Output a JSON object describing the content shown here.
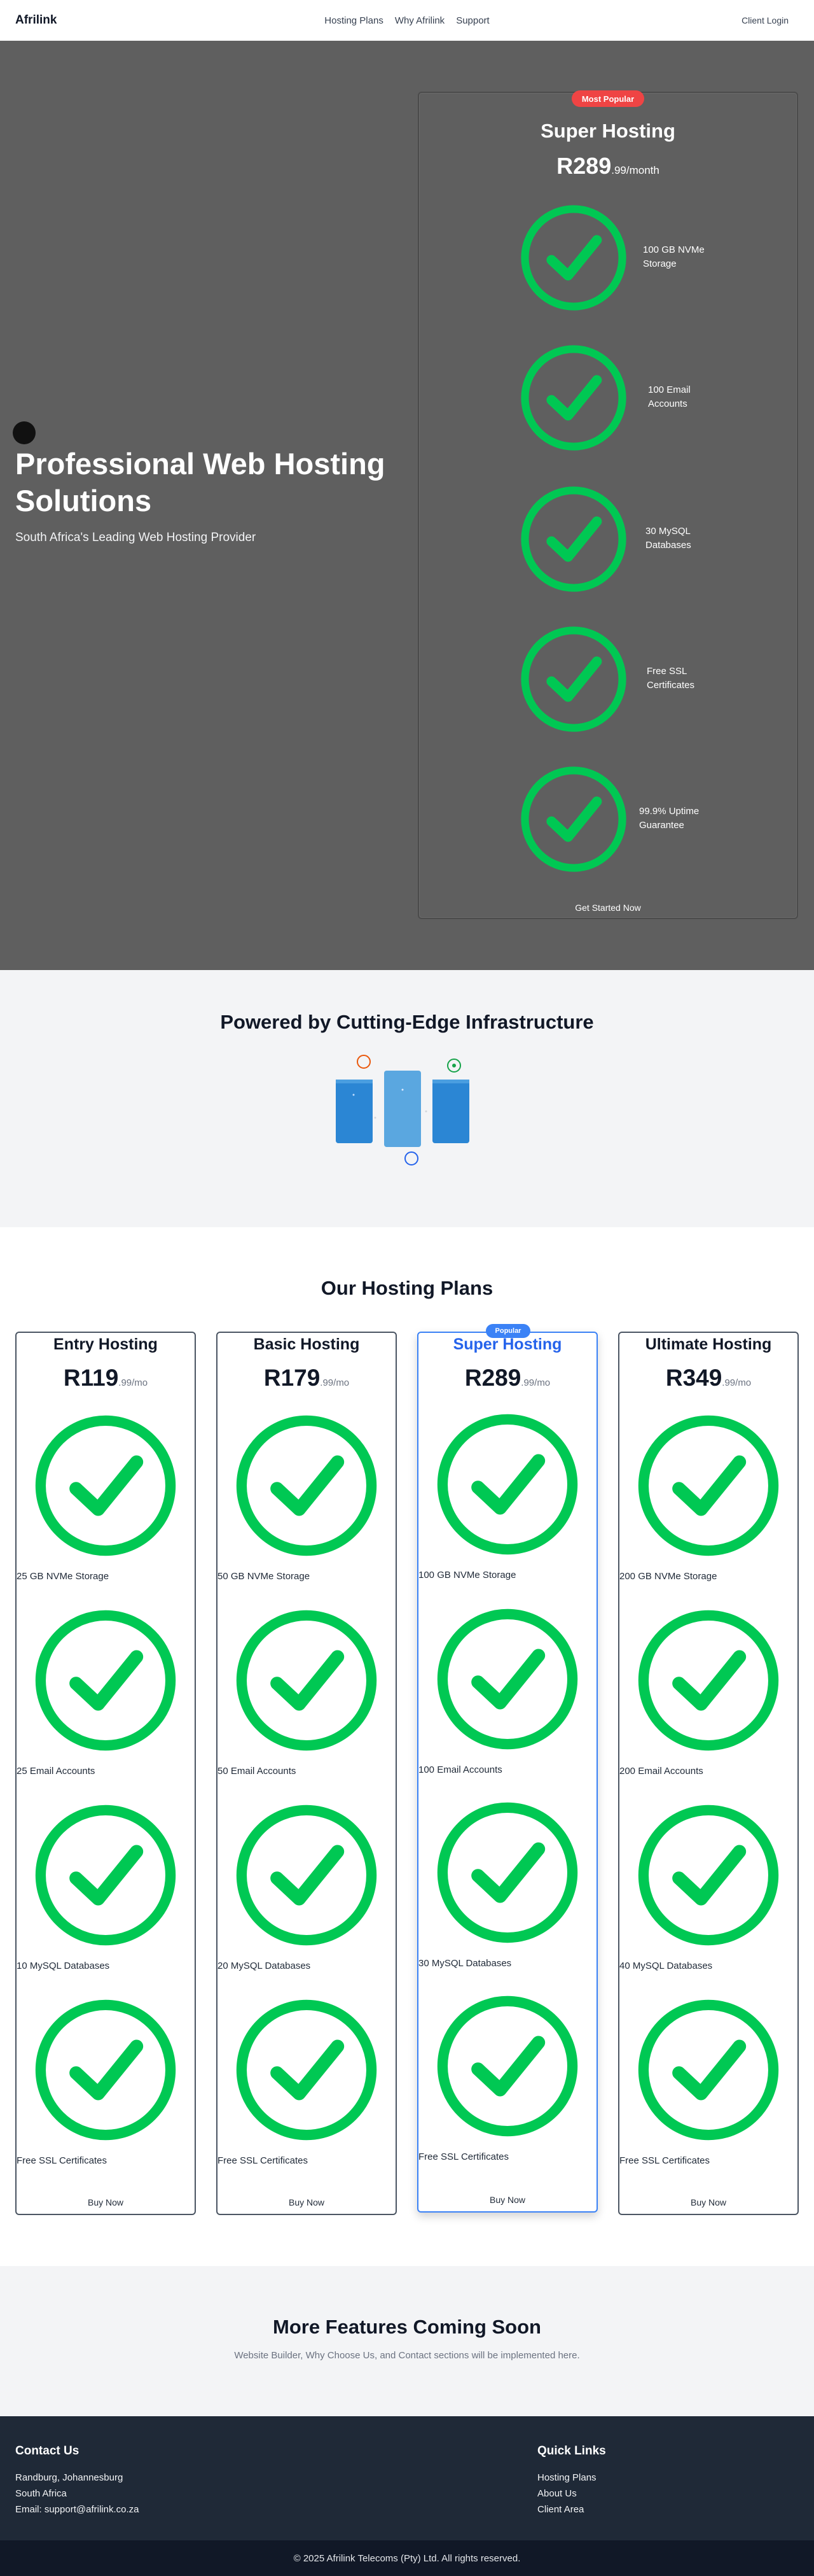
{
  "header": {
    "brand": "Afrilink",
    "nav": [
      "Hosting Plans",
      "Why Afrilink",
      "Support"
    ],
    "client_login": "Client Login"
  },
  "hero": {
    "title": "Professional Web Hosting Solutions",
    "subtitle": "South Africa's Leading Web Hosting Provider",
    "card": {
      "badge": "Most Popular",
      "title": "Super Hosting",
      "price_main": "R289",
      "price_suffix": ".99/month",
      "features": [
        "100 GB NVMe Storage",
        "100 Email Accounts",
        "30 MySQL Databases",
        "Free SSL Certificates",
        "99.9% Uptime Guarantee"
      ],
      "cta": "Get Started Now"
    }
  },
  "infrastructure": {
    "title": "Powered by Cutting-Edge Infrastructure"
  },
  "plans": {
    "title": "Our Hosting Plans",
    "items": [
      {
        "name": "Entry Hosting",
        "price_main": "R119",
        "price_suffix": ".99/mo",
        "features": [
          "25 GB NVMe Storage",
          "25 Email Accounts",
          "10 MySQL Databases",
          "Free SSL Certificates"
        ],
        "cta": "Buy Now"
      },
      {
        "name": "Basic Hosting",
        "price_main": "R179",
        "price_suffix": ".99/mo",
        "features": [
          "50 GB NVMe Storage",
          "50 Email Accounts",
          "20 MySQL Databases",
          "Free SSL Certificates"
        ],
        "cta": "Buy Now"
      },
      {
        "name": "Super Hosting",
        "badge": "Popular",
        "price_main": "R289",
        "price_suffix": ".99/mo",
        "features": [
          "100 GB NVMe Storage",
          "100 Email Accounts",
          "30 MySQL Databases",
          "Free SSL Certificates"
        ],
        "cta": "Buy Now"
      },
      {
        "name": "Ultimate Hosting",
        "price_main": "R349",
        "price_suffix": ".99/mo",
        "features": [
          "200 GB NVMe Storage",
          "200 Email Accounts",
          "40 MySQL Databases",
          "Free SSL Certificates"
        ],
        "cta": "Buy Now"
      }
    ]
  },
  "coming_soon": {
    "title": "More Features Coming Soon",
    "subtitle": "Website Builder, Why Choose Us, and Contact sections will be implemented here."
  },
  "footer": {
    "contact_title": "Contact Us",
    "contact_lines": [
      "Randburg, Johannesburg",
      "South Africa",
      "Email: support@afrilink.co.za"
    ],
    "links_title": "Quick Links",
    "links": [
      "Hosting Plans",
      "About Us",
      "Client Area"
    ],
    "copyright": "© 2025 Afrilink Telecoms (Pty) Ltd. All rights reserved."
  },
  "colors": {
    "check_green": "#00c853",
    "popular_red": "#ef4444",
    "popular_blue": "#3b82f6",
    "hero_bg": "#5f5f5f",
    "footer_bg": "#1f2937"
  },
  "icons": {
    "feature": "check-circle-icon",
    "infra": "server-stack-icon"
  }
}
